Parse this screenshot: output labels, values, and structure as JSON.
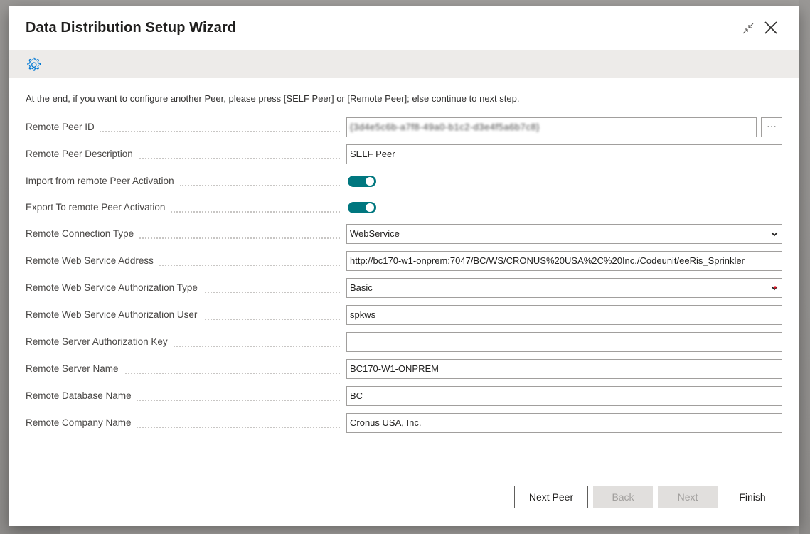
{
  "dialog": {
    "title": "Data Distribution Setup Wizard",
    "instruction": "At the end, if you want to configure another Peer, please press [SELF Peer] or [Remote Peer]; else continue to next step."
  },
  "icons": {
    "gear": "gear-icon",
    "collapse": "collapse-icon",
    "close": "close-icon",
    "lookup": "ellipsis-icon",
    "dropdown": "chevron-down-icon"
  },
  "colors": {
    "accent": "#00777f",
    "actionbar": "#edebe9",
    "gear": "#0078d4"
  },
  "fields": {
    "remote_peer_id": {
      "label": "Remote Peer ID",
      "value": "{3d4e5c6b-a7f8-49a0-b1c2-d3e4f5a6b7c8}",
      "lookup_label": "···"
    },
    "remote_peer_description": {
      "label": "Remote Peer Description",
      "value": "SELF Peer"
    },
    "import_activation": {
      "label": "Import from remote Peer Activation",
      "value": true
    },
    "export_activation": {
      "label": "Export To remote Peer Activation",
      "value": true
    },
    "connection_type": {
      "label": "Remote Connection Type",
      "value": "WebService"
    },
    "web_service_address": {
      "label": "Remote Web Service Address",
      "value": "http://bc170-w1-onprem:7047/BC/WS/CRONUS%20USA%2C%20Inc./Codeunit/eeRis_Sprinkler"
    },
    "auth_type": {
      "label": "Remote Web Service Authorization Type",
      "value": "Basic"
    },
    "auth_user": {
      "label": "Remote Web Service Authorization User",
      "value": "spkws"
    },
    "auth_key": {
      "label": "Remote Server Authorization Key",
      "value": ""
    },
    "server_name": {
      "label": "Remote Server Name",
      "value": "BC170-W1-ONPREM"
    },
    "database_name": {
      "label": "Remote Database Name",
      "value": "BC"
    },
    "company_name": {
      "label": "Remote Company Name",
      "value": "Cronus USA, Inc."
    }
  },
  "buttons": {
    "next_peer": "Next Peer",
    "back": "Back",
    "next": "Next",
    "finish": "Finish"
  }
}
